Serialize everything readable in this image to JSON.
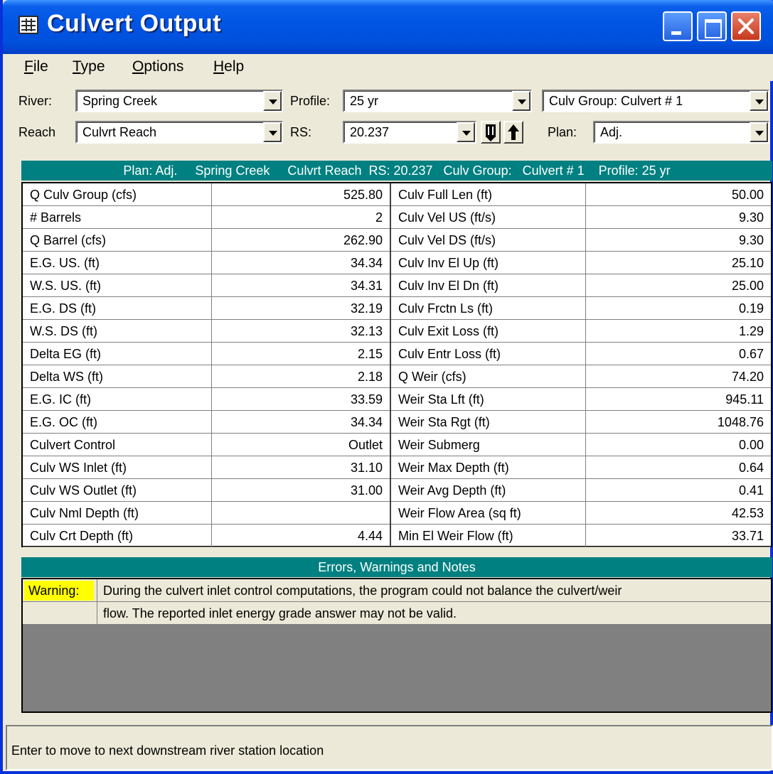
{
  "window": {
    "title": "Culvert Output",
    "icon": "table-window-icon"
  },
  "menu": [
    {
      "label": "File",
      "key": "F"
    },
    {
      "label": "Type",
      "key": "T"
    },
    {
      "label": "Options",
      "key": "O"
    },
    {
      "label": "Help",
      "key": "H"
    }
  ],
  "selectors": {
    "river_label": "River:",
    "river_value": "Spring Creek",
    "reach_label": "Reach",
    "reach_value": "Culvrt Reach",
    "profile_label": "Profile:",
    "profile_value": "25 yr",
    "rs_label": "RS:",
    "rs_value": "20.237",
    "culv_group_value": "Culv Group:  Culvert # 1",
    "plan_label": "Plan:",
    "plan_value": "Adj.",
    "rs_next_icon": "next-downstream-icon",
    "rs_prev_icon": "up-arrow-icon"
  },
  "header": "Plan: Adj.     Spring Creek     Culvrt Reach  RS: 20.237   Culv Group:   Culvert # 1    Profile: 25 yr",
  "table": [
    [
      "Q Culv Group (cfs)",
      "525.80",
      "Culv Full Len (ft)",
      "50.00"
    ],
    [
      "# Barrels",
      "2",
      "Culv Vel US (ft/s)",
      "9.30"
    ],
    [
      "Q Barrel (cfs)",
      "262.90",
      "Culv Vel DS (ft/s)",
      "9.30"
    ],
    [
      "E.G. US. (ft)",
      "34.34",
      "Culv Inv El Up (ft)",
      "25.10"
    ],
    [
      "W.S. US. (ft)",
      "34.31",
      "Culv Inv El Dn (ft)",
      "25.00"
    ],
    [
      "E.G. DS (ft)",
      "32.19",
      "Culv Frctn Ls (ft)",
      "0.19"
    ],
    [
      "W.S. DS (ft)",
      "32.13",
      "Culv Exit Loss (ft)",
      "1.29"
    ],
    [
      "Delta EG (ft)",
      "2.15",
      "Culv Entr Loss (ft)",
      "0.67"
    ],
    [
      "Delta WS (ft)",
      "2.18",
      "Q Weir (cfs)",
      "74.20"
    ],
    [
      "E.G. IC (ft)",
      "33.59",
      "Weir Sta Lft (ft)",
      "945.11"
    ],
    [
      "E.G. OC (ft)",
      "34.34",
      "Weir Sta Rgt (ft)",
      "1048.76"
    ],
    [
      "Culvert Control",
      "Outlet",
      "Weir Submerg",
      "0.00"
    ],
    [
      "Culv WS Inlet (ft)",
      "31.10",
      "Weir Max Depth (ft)",
      "0.64"
    ],
    [
      "Culv WS Outlet (ft)",
      "31.00",
      "Weir Avg Depth (ft)",
      "0.41"
    ],
    [
      "Culv Nml Depth (ft)",
      "",
      "Weir Flow Area (sq ft)",
      "42.53"
    ],
    [
      "Culv Crt Depth (ft)",
      "4.44",
      "Min El Weir Flow (ft)",
      "33.71"
    ]
  ],
  "notes": {
    "title": "Errors, Warnings and Notes",
    "rows": [
      {
        "tag": "Warning:",
        "text": "During the culvert inlet control computations, the program could not balance the culvert/weir"
      },
      {
        "tag": "",
        "text": "flow.  The reported inlet energy grade answer may not be valid."
      }
    ],
    "warning_color": "#FFFF00"
  },
  "status": "Enter to move to next downstream river station location",
  "colors": {
    "title_blue": "#0054E3",
    "header_teal": "#008080",
    "face": "#ECE9D8"
  }
}
